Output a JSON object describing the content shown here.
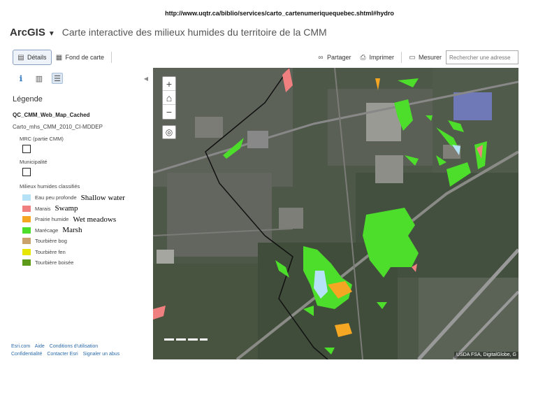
{
  "url_text": "http://www.uqtr.ca/biblio/services/carto_cartenumeriquequebec.shtml#hydro",
  "header": {
    "brand": "ArcGIS",
    "title": "Carte interactive des milieux humides du territoire de la CMM"
  },
  "toolbar": {
    "details_label": "Détails",
    "basemap_label": "Fond de carte",
    "share_label": "Partager",
    "print_label": "Imprimer",
    "measure_label": "Mesurer",
    "search_placeholder": "Rechercher une adresse"
  },
  "sidebar": {
    "legend_title": "Légende",
    "layer_title": "QC_CMM_Web_Map_Cached",
    "sublayer": "Carto_mhs_CMM_2010_CI-MDDEP",
    "groups": [
      {
        "label": "MRC (partie CMM)"
      },
      {
        "label": "Municipalité"
      }
    ],
    "wetlands_label": "Milieux humides classifiés",
    "items": [
      {
        "label": "Eau peu profonde",
        "color": "#b5e2f7",
        "annotation": "Shallow water"
      },
      {
        "label": "Marais",
        "color": "#f08080",
        "annotation": "Swamp"
      },
      {
        "label": "Prairie humide",
        "color": "#f5a623",
        "annotation": "Wet meadows"
      },
      {
        "label": "Marécage",
        "color": "#4cde2a",
        "annotation": "Marsh"
      },
      {
        "label": "Tourbière bog",
        "color": "#c9a36b",
        "annotation": ""
      },
      {
        "label": "Tourbière fen",
        "color": "#e6e600",
        "annotation": ""
      },
      {
        "label": "Tourbière boisée",
        "color": "#5e9a1a",
        "annotation": ""
      }
    ],
    "footer_links_1": [
      "Esri.com",
      "Aide",
      "Conditions d'utilisation"
    ],
    "footer_links_2": [
      "Confidentialité",
      "Contacter Esri",
      "Signaler un abus"
    ]
  },
  "map": {
    "zoom_in": "+",
    "home": "⌂",
    "zoom_out": "−",
    "locate": "◎",
    "attribution": "USDA FSA, DigitalGlobe, G"
  }
}
